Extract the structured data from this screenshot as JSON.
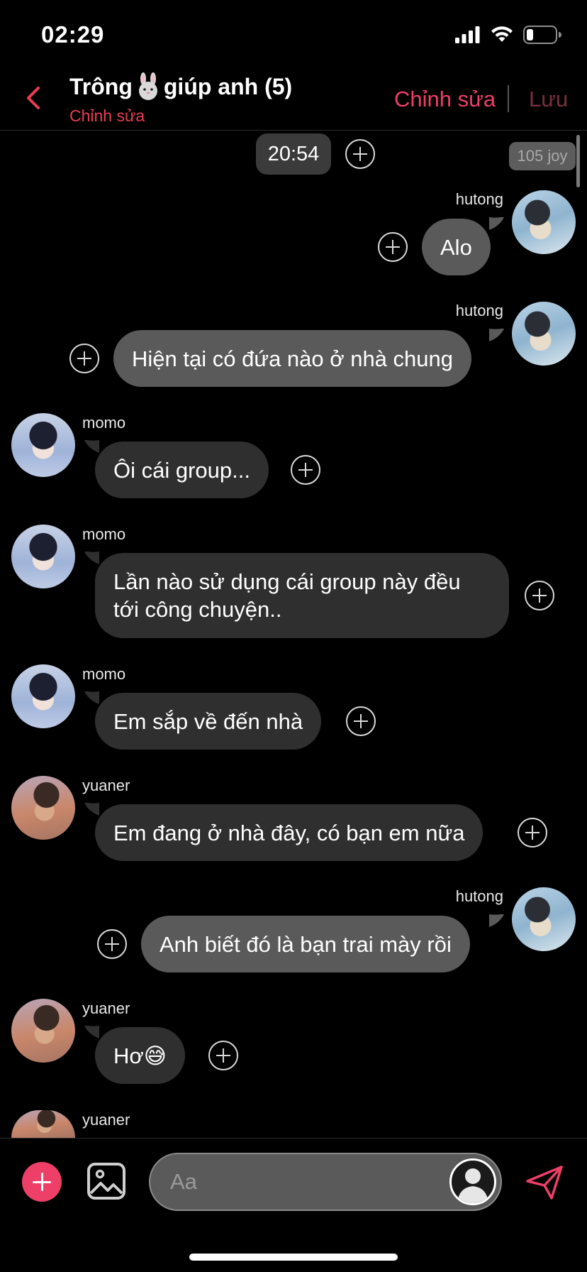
{
  "status_bar": {
    "time": "02:29"
  },
  "header": {
    "title_prefix": "Trông",
    "title_suffix": "giúp anh (5)",
    "subtitle": "Chỉnh sửa",
    "edit_label": "Chỉnh sửa",
    "save_label": "Lưu"
  },
  "chat": {
    "timestamp": "20:54",
    "joy_badge": "105 joy",
    "messages": [
      {
        "sender": "hutong",
        "text": "Alo",
        "side": "right"
      },
      {
        "sender": "hutong",
        "text": "Hiện tại có đứa nào ở nhà chung",
        "side": "right"
      },
      {
        "sender": "momo",
        "text": "Ôi cái group...",
        "side": "left"
      },
      {
        "sender": "momo",
        "text_line1": "Lần nào sử dụng cái group này đều",
        "text_line2": "tới công chuyện..",
        "side": "left"
      },
      {
        "sender": "momo",
        "text": "Em sắp về đến nhà",
        "side": "left"
      },
      {
        "sender": "yuaner",
        "text": "Em đang ở nhà đây, có bạn em nữa",
        "side": "left"
      },
      {
        "sender": "hutong",
        "text": "Anh biết đó là bạn trai mày rồi",
        "side": "right"
      },
      {
        "sender": "yuaner",
        "text": "Hơ",
        "emoji": "😅",
        "side": "left"
      },
      {
        "sender": "yuaner",
        "side": "left"
      }
    ]
  },
  "input": {
    "placeholder": "Aa"
  },
  "colors": {
    "accent": "#ee3f68",
    "bubble_mine": "#5a5a5a",
    "bubble_theirs": "#2f2f2f"
  }
}
